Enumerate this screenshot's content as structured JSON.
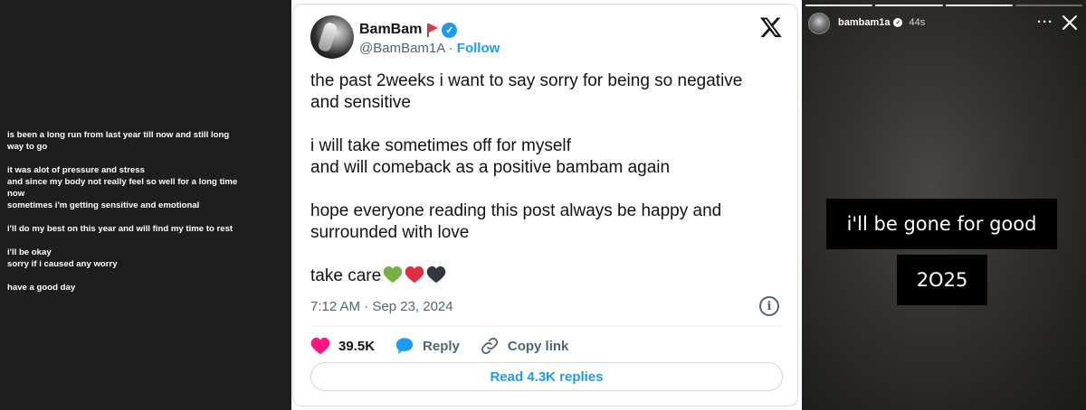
{
  "note": {
    "paragraphs": [
      [
        "is been a long run from last year till now and still long",
        "way to go"
      ],
      [
        "it was alot of pressure and stress",
        "and since my body not really feel so well for a long time",
        "now",
        "sometimes i'm getting sensitive and emotional"
      ],
      [
        "i'll do my best on this year and will find my time to rest"
      ],
      [
        "i'll be okay",
        "sorry if i caused any worry"
      ],
      [
        "have a good day"
      ]
    ]
  },
  "tweet": {
    "display_name": "BamBam",
    "handle": "@BamBam1A",
    "separator": "·",
    "follow_label": "Follow",
    "paragraphs": [
      [
        "the past 2weeks i want to say sorry for being so negative",
        "and sensitive"
      ],
      [
        "i will take sometimes off for myself",
        "and will comeback as a positive bambam again"
      ],
      [
        "hope everyone reading this post always be happy and",
        "surrounded with love"
      ]
    ],
    "closing": "take care",
    "closing_emoji": [
      "green-heart",
      "red-heart",
      "black-heart"
    ],
    "timestamp": "7:12 AM · Sep 23, 2024",
    "likes": "39.5K",
    "reply_label": "Reply",
    "copy_link_label": "Copy link",
    "read_replies_label": "Read 4.3K replies",
    "colors": {
      "accent": "#1d9bf0",
      "like": "#f91880",
      "text": "#0f1419",
      "muted": "#536471"
    }
  },
  "story": {
    "username": "bambam1a",
    "time_ago": "44s",
    "more_label": "···",
    "caption": "i'll be gone for good",
    "year_text": "2O25",
    "progress": {
      "segments": 4,
      "completed": 3
    }
  }
}
